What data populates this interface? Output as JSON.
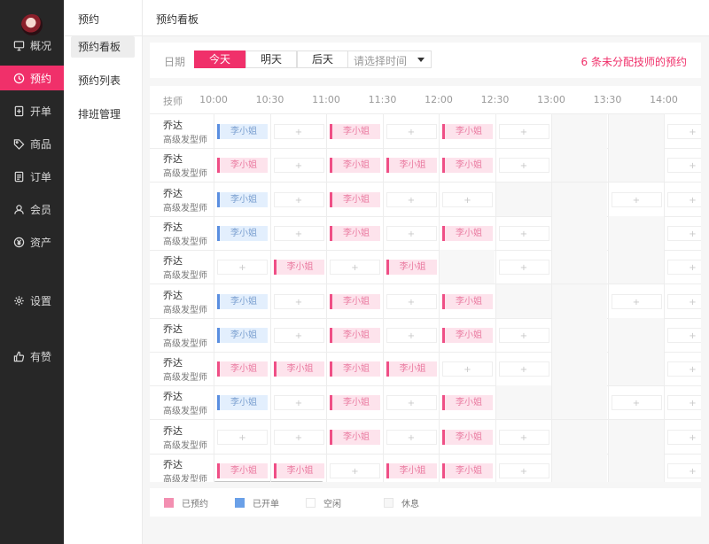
{
  "nav": {
    "items": [
      {
        "label": "概况",
        "icon": "monitor-icon",
        "active": false
      },
      {
        "label": "预约",
        "icon": "clock-icon",
        "active": true
      },
      {
        "label": "开单",
        "icon": "add-doc-icon",
        "active": false
      },
      {
        "label": "商品",
        "icon": "tag-icon",
        "active": false
      },
      {
        "label": "订单",
        "icon": "order-list-icon",
        "active": false
      },
      {
        "label": "会员",
        "icon": "user-icon",
        "active": false
      },
      {
        "label": "资产",
        "icon": "yen-icon",
        "active": false
      },
      {
        "label": "设置",
        "icon": "gear-icon",
        "active": false
      },
      {
        "label": "有赞",
        "icon": "thumbs-up-icon",
        "active": false
      }
    ]
  },
  "subnav": {
    "title": "预约",
    "items": [
      {
        "label": "预约看板",
        "active": true
      },
      {
        "label": "预约列表",
        "active": false
      },
      {
        "label": "排班管理",
        "active": false
      }
    ]
  },
  "header": {
    "title": "预约看板"
  },
  "filter": {
    "date_label": "日期",
    "days": [
      {
        "label": "今天",
        "selected": true
      },
      {
        "label": "明天",
        "selected": false
      },
      {
        "label": "后天",
        "selected": false
      }
    ],
    "select_placeholder": "请选择时间",
    "unassigned_text": "6 条未分配技师的预约"
  },
  "board": {
    "tech_header": "技师",
    "times": [
      "10:00",
      "10:30",
      "11:00",
      "11:30",
      "12:00",
      "12:30",
      "13:00",
      "13:30",
      "14:00"
    ],
    "rows": [
      {
        "name": "乔达",
        "title": "高级发型师",
        "slots": [
          "O:李小姐",
          "E:+",
          "B:李小姐",
          "E:+",
          "B:李小姐",
          "E:+",
          "R",
          "R",
          "E:+"
        ]
      },
      {
        "name": "乔达",
        "title": "高级发型师",
        "slots": [
          "B:李小姐",
          "E:+",
          "B:李小姐",
          "B:李小姐",
          "B:李小姐",
          "E:+",
          "R",
          "R",
          "E:+"
        ]
      },
      {
        "name": "乔达",
        "title": "高级发型师",
        "slots": [
          "O:李小姐",
          "E:+",
          "B:李小姐",
          "E:+",
          "E:+",
          "R",
          "R",
          "E:+",
          "E:+"
        ]
      },
      {
        "name": "乔达",
        "title": "高级发型师",
        "slots": [
          "O:李小姐",
          "E:+",
          "B:李小姐",
          "E:+",
          "B:李小姐",
          "E:+",
          "R",
          "R",
          "E:+"
        ]
      },
      {
        "name": "乔达",
        "title": "高级发型师",
        "slots": [
          "E:+",
          "B:李小姐",
          "E:+",
          "B:李小姐",
          "R",
          "E:+",
          "R",
          "R",
          "E:+"
        ]
      },
      {
        "name": "乔达",
        "title": "高级发型师",
        "slots": [
          "O:李小姐",
          "E:+",
          "B:李小姐",
          "E:+",
          "B:李小姐",
          "R",
          "R",
          "E:+",
          "E:+"
        ]
      },
      {
        "name": "乔达",
        "title": "高级发型师",
        "slots": [
          "O:李小姐",
          "E:+",
          "B:李小姐",
          "E:+",
          "B:李小姐",
          "E:+",
          "R",
          "R",
          "E:+"
        ]
      },
      {
        "name": "乔达",
        "title": "高级发型师",
        "slots": [
          "B:李小姐",
          "B:李小姐",
          "B:李小姐",
          "B:李小姐",
          "E:+",
          "E:+",
          "R",
          "R",
          "E:+"
        ]
      },
      {
        "name": "乔达",
        "title": "高级发型师",
        "slots": [
          "O:李小姐",
          "E:+",
          "B:李小姐",
          "E:+",
          "B:李小姐",
          "R",
          "R",
          "E:+",
          "E:+"
        ]
      },
      {
        "name": "乔达",
        "title": "高级发型师",
        "slots": [
          "E:+",
          "E:+",
          "B:李小姐",
          "E:+",
          "B:李小姐",
          "E:+",
          "R",
          "R",
          "E:+"
        ]
      },
      {
        "name": "乔达",
        "title": "高级发型师",
        "slots": [
          "B:李小姐",
          "B:李小姐",
          "E:+",
          "B:李小姐",
          "B:李小姐",
          "E:+",
          "R",
          "R",
          "E:+"
        ]
      }
    ]
  },
  "legend": [
    {
      "label": "已预约",
      "color": "#f38fb1"
    },
    {
      "label": "已开单",
      "color": "#6aa0e8"
    },
    {
      "label": "空闲",
      "color": "#ffffff"
    },
    {
      "label": "休息",
      "color": "#f7f7f7"
    }
  ]
}
